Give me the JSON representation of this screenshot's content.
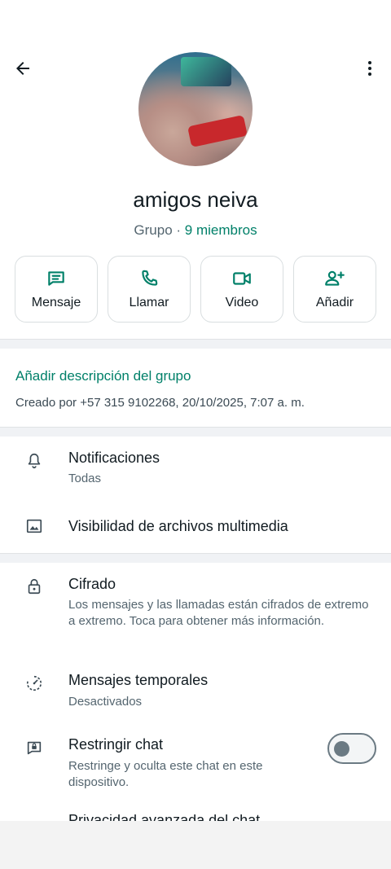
{
  "header": {
    "back_icon": "arrow-left-icon",
    "more_icon": "more-vertical-icon"
  },
  "group": {
    "name": "amigos neiva",
    "type_label": "Grupo",
    "separator": " · ",
    "members": "9 miembros"
  },
  "actions": [
    {
      "label": "Mensaje",
      "icon": "message-icon"
    },
    {
      "label": "Llamar",
      "icon": "phone-icon"
    },
    {
      "label": "Video",
      "icon": "video-icon"
    },
    {
      "label": "Añadir",
      "icon": "add-person-icon"
    }
  ],
  "description": {
    "add_label": "Añadir descripción del grupo",
    "created": "Creado por +57 315 9102268, 20/10/2025, 7:07 a. m."
  },
  "settings": {
    "notifications": {
      "title": "Notificaciones",
      "value": "Todas"
    },
    "media": {
      "title": "Visibilidad de archivos multimedia"
    },
    "encryption": {
      "title": "Cifrado",
      "value": "Los mensajes y las llamadas están cifrados de extremo a extremo. Toca para obtener más información."
    },
    "temporary": {
      "title": "Mensajes temporales",
      "value": "Desactivados"
    },
    "restrict": {
      "title": "Restringir chat",
      "value": "Restringe y oculta este chat en este dispositivo.",
      "enabled": false
    },
    "privacy_partial": {
      "title": "Privacidad avanzada del chat"
    }
  },
  "colors": {
    "accent": "#008069",
    "text": "#111b21",
    "secondary": "#54656f"
  }
}
